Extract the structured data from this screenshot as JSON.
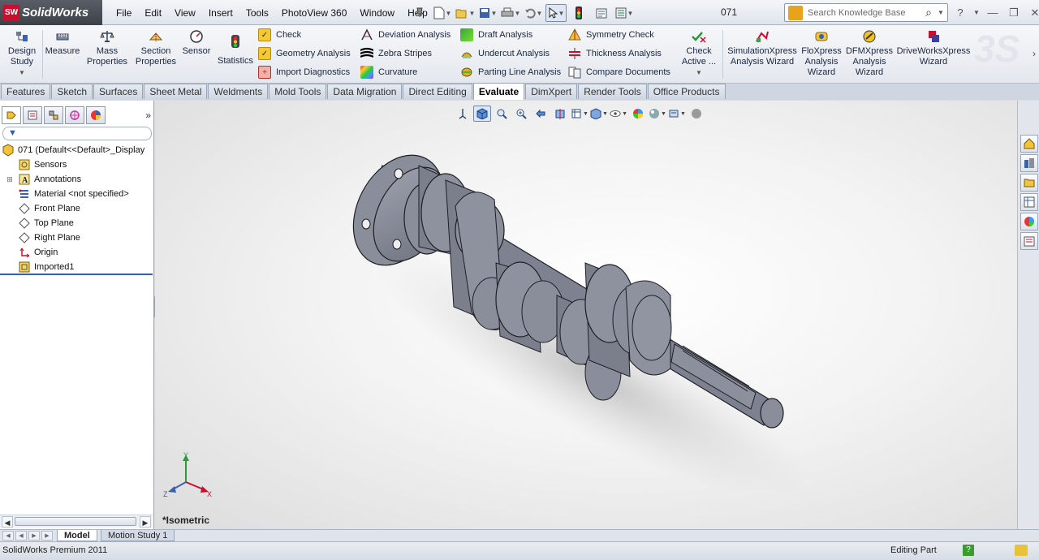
{
  "app": {
    "logo_text": "SolidWorks",
    "doc_name": "071"
  },
  "menu": [
    "File",
    "Edit",
    "View",
    "Insert",
    "Tools",
    "PhotoView 360",
    "Window",
    "Help"
  ],
  "search": {
    "placeholder": "Search Knowledge Base"
  },
  "command_manager": {
    "big": [
      {
        "label1": "Design",
        "label2": "Study",
        "icon": "design-study-icon"
      },
      {
        "label1": "Measure",
        "label2": "",
        "icon": "measure-icon"
      },
      {
        "label1": "Mass",
        "label2": "Properties",
        "icon": "mass-properties-icon"
      },
      {
        "label1": "Section",
        "label2": "Properties",
        "icon": "section-properties-icon"
      },
      {
        "label1": "Sensor",
        "label2": "",
        "icon": "sensor-icon"
      },
      {
        "label1": "Statistics",
        "label2": "",
        "icon": "statistics-icon"
      }
    ],
    "col1": [
      "Check",
      "Geometry Analysis",
      "Import Diagnostics"
    ],
    "col2": [
      "Deviation Analysis",
      "Zebra Stripes",
      "Curvature"
    ],
    "col3": [
      "Draft Analysis",
      "Undercut Analysis",
      "Parting Line Analysis"
    ],
    "col4": [
      "Symmetry Check",
      "Thickness Analysis",
      "Compare Documents"
    ],
    "check_active": {
      "label1": "Check",
      "label2": "Active ..."
    },
    "xpress": [
      {
        "label1": "SimulationXpress",
        "label2": "Analysis Wizard",
        "label3": ""
      },
      {
        "label1": "FloXpress",
        "label2": "Analysis",
        "label3": "Wizard"
      },
      {
        "label1": "DFMXpress",
        "label2": "Analysis",
        "label3": "Wizard"
      },
      {
        "label1": "DriveWorksXpress",
        "label2": "Wizard",
        "label3": ""
      }
    ]
  },
  "tabs": [
    "Features",
    "Sketch",
    "Surfaces",
    "Sheet Metal",
    "Weldments",
    "Mold Tools",
    "Data Migration",
    "Direct Editing",
    "Evaluate",
    "DimXpert",
    "Render Tools",
    "Office Products"
  ],
  "active_tab": "Evaluate",
  "tree": {
    "root": "071  (Default<<Default>_Display",
    "items": [
      "Sensors",
      "Annotations",
      "Material <not specified>",
      "Front Plane",
      "Top Plane",
      "Right Plane",
      "Origin",
      "Imported1"
    ]
  },
  "viewport": {
    "view_label": "*Isometric",
    "triad": {
      "x": "X",
      "y": "Y",
      "z": "Z"
    }
  },
  "bottom_tabs": [
    "Model",
    "Motion Study 1"
  ],
  "status": {
    "left": "SolidWorks Premium 2011",
    "right": "Editing Part",
    "help": "?"
  },
  "colors": {
    "part_fill": "#8a8e9a",
    "accent_blue": "#2d63b5",
    "logo_red": "#c8102e"
  }
}
